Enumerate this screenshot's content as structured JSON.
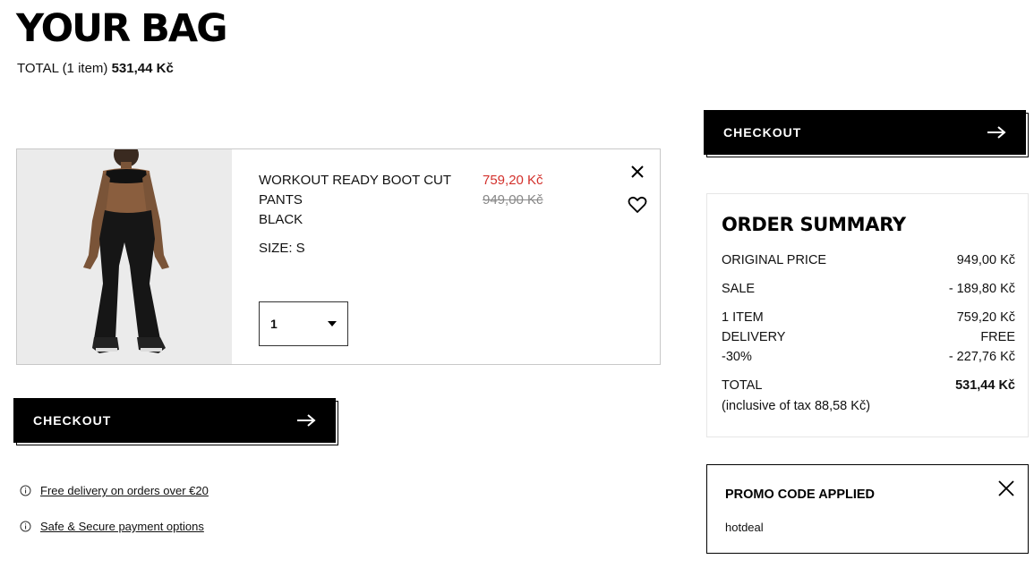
{
  "page": {
    "title": "YOUR BAG"
  },
  "total": {
    "label": "TOTAL (1 item)",
    "amount": "531,44 Kč"
  },
  "checkout": {
    "label": "CHECKOUT",
    "icon": "arrow-right-icon"
  },
  "cart_item": {
    "name": "WORKOUT READY BOOT CUT PANTS",
    "color": "BLACK",
    "size": "SIZE: S",
    "sale_price": "759,20 Kč",
    "original_price": "949,00 Kč",
    "quantity": "1",
    "remove_icon": "close-icon",
    "wishlist_icon": "heart-icon",
    "sale_price_color": "#d3312c"
  },
  "info_links": [
    {
      "label": "Free delivery on orders over €20",
      "icon": "info-icon"
    },
    {
      "label": "Safe & Secure payment options",
      "icon": "info-icon"
    }
  ],
  "order_summary": {
    "title": "ORDER SUMMARY",
    "rows": [
      {
        "label": "ORIGINAL PRICE",
        "value": "949,00 Kč"
      },
      {
        "label": "SALE",
        "value": "- 189,80 Kč"
      },
      {
        "label": "1 ITEM",
        "value": "759,20 Kč"
      },
      {
        "label": "DELIVERY",
        "value": "FREE"
      },
      {
        "label": "-30%",
        "value": "- 227,76 Kč"
      },
      {
        "label": "TOTAL",
        "value": "531,44 Kč"
      }
    ],
    "tax_note": "(inclusive of tax  88,58 Kč)"
  },
  "promo": {
    "title": "PROMO CODE APPLIED",
    "code": "hotdeal",
    "close_icon": "close-icon"
  }
}
